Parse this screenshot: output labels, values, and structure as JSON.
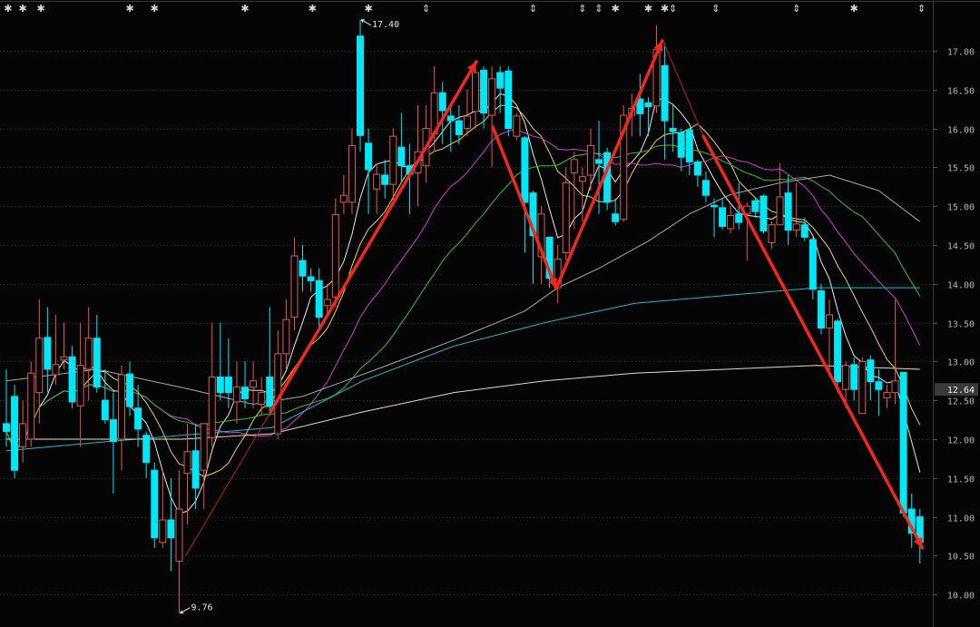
{
  "chart_data": {
    "type": "candlestick",
    "title": "",
    "ylim": [
      9.7,
      17.4
    ],
    "y_ticks": [
      "17.00",
      "16.50",
      "16.00",
      "15.50",
      "15.00",
      "14.50",
      "14.00",
      "13.50",
      "13.00",
      "12.50",
      "12.00",
      "11.50",
      "11.00",
      "10.50",
      "10.00"
    ],
    "current_price": "12.64",
    "high_label": "17.40",
    "low_label": "9.76",
    "high_value": 17.4,
    "low_value": 9.76,
    "high_index": 43,
    "low_index": 21,
    "colors": {
      "up": "#e05a50",
      "down": "#00e8f8",
      "background": "#050505",
      "grid": "#3a3a3a",
      "trend": "#f0281e",
      "trend_thin": "#a0201a"
    },
    "ohlc": [
      [
        12.2,
        12.9,
        11.9,
        12.1
      ],
      [
        12.55,
        12.7,
        11.5,
        11.6
      ],
      [
        11.9,
        12.5,
        11.7,
        12.2
      ],
      [
        12.0,
        13.0,
        11.9,
        12.85
      ],
      [
        12.6,
        13.8,
        12.2,
        13.3
      ],
      [
        13.31,
        13.7,
        12.6,
        12.9
      ],
      [
        12.83,
        13.6,
        12.7,
        12.96
      ],
      [
        13.02,
        13.5,
        12.9,
        13.06
      ],
      [
        13.06,
        13.2,
        12.4,
        12.48
      ],
      [
        12.43,
        13.5,
        11.9,
        12.95
      ],
      [
        12.9,
        13.7,
        12.5,
        13.3
      ],
      [
        13.3,
        13.6,
        12.6,
        12.67
      ],
      [
        12.5,
        12.9,
        12.2,
        12.25
      ],
      [
        12.25,
        12.6,
        11.3,
        11.97
      ],
      [
        12.0,
        12.95,
        11.6,
        12.83
      ],
      [
        12.84,
        13.0,
        12.3,
        12.42
      ],
      [
        12.4,
        12.7,
        11.9,
        12.13
      ],
      [
        12.05,
        12.1,
        11.5,
        11.7
      ],
      [
        11.6,
        11.7,
        10.6,
        10.73
      ],
      [
        10.67,
        11.6,
        10.6,
        10.96
      ],
      [
        10.96,
        11.5,
        10.3,
        10.73
      ],
      [
        10.43,
        11.6,
        9.76,
        11.1
      ],
      [
        11.56,
        12.2,
        10.9,
        11.84
      ],
      [
        11.85,
        12.2,
        11.1,
        11.37
      ],
      [
        11.6,
        12.2,
        11.1,
        12.2
      ],
      [
        12.02,
        13.5,
        11.9,
        12.8
      ],
      [
        12.8,
        13.5,
        12.5,
        12.6
      ],
      [
        12.8,
        13.3,
        12.4,
        12.6
      ],
      [
        12.48,
        13.0,
        12.2,
        12.67
      ],
      [
        12.67,
        13.0,
        12.4,
        12.52
      ],
      [
        12.67,
        13.0,
        12.4,
        12.75
      ],
      [
        12.45,
        12.8,
        12.3,
        12.6
      ],
      [
        12.8,
        13.7,
        12.3,
        12.42
      ],
      [
        12.07,
        13.4,
        12.0,
        13.1
      ],
      [
        13.1,
        13.8,
        12.9,
        13.54
      ],
      [
        13.57,
        14.6,
        13.4,
        14.36
      ],
      [
        14.3,
        14.5,
        13.9,
        14.1
      ],
      [
        14.09,
        14.2,
        13.9,
        14.04
      ],
      [
        14.04,
        14.2,
        13.4,
        13.57
      ],
      [
        13.72,
        14.0,
        13.6,
        13.8
      ],
      [
        13.83,
        15.1,
        13.7,
        14.89
      ],
      [
        15.05,
        15.4,
        14.9,
        15.14
      ],
      [
        15.05,
        16.0,
        14.9,
        15.78
      ],
      [
        17.19,
        17.4,
        15.7,
        15.91
      ],
      [
        15.81,
        16.0,
        14.9,
        15.47
      ],
      [
        15.22,
        15.55,
        14.9,
        15.41
      ],
      [
        15.4,
        15.6,
        15.1,
        15.28
      ],
      [
        15.28,
        16.0,
        15.0,
        15.9
      ],
      [
        15.76,
        16.2,
        15.3,
        15.52
      ],
      [
        15.52,
        15.8,
        14.9,
        15.41
      ],
      [
        15.43,
        16.3,
        15.0,
        15.7
      ],
      [
        15.52,
        16.3,
        15.3,
        16.0
      ],
      [
        15.93,
        16.8,
        15.7,
        16.46
      ],
      [
        16.46,
        16.6,
        15.8,
        16.23
      ],
      [
        16.16,
        16.3,
        15.7,
        16.1
      ],
      [
        16.1,
        16.3,
        15.8,
        15.92
      ],
      [
        16.0,
        16.5,
        15.9,
        16.16
      ],
      [
        16.22,
        16.85,
        16.0,
        16.72
      ],
      [
        16.75,
        16.8,
        16.0,
        16.2
      ],
      [
        16.17,
        16.8,
        15.5,
        16.64
      ],
      [
        16.72,
        16.8,
        16.2,
        16.52
      ],
      [
        16.74,
        16.8,
        15.9,
        16.0
      ],
      [
        15.9,
        16.2,
        15.85,
        16.16
      ],
      [
        15.88,
        15.9,
        14.4,
        15.05
      ],
      [
        15.17,
        15.2,
        14.0,
        14.62
      ],
      [
        14.35,
        15.0,
        14.0,
        14.9
      ],
      [
        14.6,
        14.6,
        13.95,
        14.07
      ],
      [
        13.95,
        14.5,
        13.75,
        14.32
      ],
      [
        14.4,
        15.5,
        14.3,
        15.3
      ],
      [
        15.43,
        15.7,
        14.7,
        15.6
      ],
      [
        15.32,
        15.5,
        14.8,
        15.38
      ],
      [
        15.4,
        16.0,
        15.2,
        15.78
      ],
      [
        15.6,
        16.1,
        14.9,
        15.55
      ],
      [
        15.69,
        15.75,
        14.95,
        15.05
      ],
      [
        14.9,
        15.1,
        14.75,
        14.8
      ],
      [
        14.83,
        16.3,
        14.8,
        16.17
      ],
      [
        16.17,
        16.45,
        15.9,
        16.26
      ],
      [
        16.38,
        16.7,
        15.9,
        16.19
      ],
      [
        16.33,
        16.4,
        15.9,
        16.28
      ],
      [
        16.29,
        17.33,
        16.2,
        17.02
      ],
      [
        16.81,
        17.1,
        15.6,
        16.1
      ],
      [
        16.0,
        16.3,
        15.7,
        15.96
      ],
      [
        15.95,
        16.0,
        15.45,
        15.63
      ],
      [
        15.98,
        16.0,
        15.4,
        15.57
      ],
      [
        15.57,
        15.6,
        15.25,
        15.4
      ],
      [
        15.33,
        15.45,
        15.05,
        15.14
      ],
      [
        15.01,
        15.1,
        14.6,
        15.0
      ],
      [
        14.98,
        15.1,
        14.7,
        14.74
      ],
      [
        14.71,
        15.0,
        14.65,
        14.88
      ],
      [
        14.9,
        15.3,
        14.7,
        14.79
      ],
      [
        14.9,
        15.05,
        14.3,
        15.0
      ],
      [
        15.07,
        15.1,
        14.85,
        14.93
      ],
      [
        15.13,
        15.15,
        14.65,
        14.68
      ],
      [
        14.53,
        14.8,
        14.45,
        14.76
      ],
      [
        14.76,
        15.55,
        14.76,
        15.12
      ],
      [
        15.17,
        15.4,
        14.5,
        14.69
      ],
      [
        14.69,
        15.3,
        14.6,
        14.77
      ],
      [
        14.76,
        14.85,
        14.55,
        14.6
      ],
      [
        14.57,
        14.6,
        13.8,
        13.93
      ],
      [
        13.91,
        14.0,
        13.35,
        13.43
      ],
      [
        13.43,
        13.8,
        12.8,
        13.6
      ],
      [
        13.52,
        13.55,
        12.6,
        12.74
      ],
      [
        12.64,
        13.0,
        12.4,
        12.95
      ],
      [
        12.96,
        13.05,
        12.5,
        12.64
      ],
      [
        12.33,
        13.05,
        12.33,
        13.0
      ],
      [
        13.02,
        13.08,
        12.5,
        12.74
      ],
      [
        12.74,
        12.9,
        12.3,
        12.64
      ],
      [
        12.53,
        12.7,
        12.4,
        12.6
      ],
      [
        12.6,
        13.8,
        12.45,
        12.75
      ],
      [
        12.86,
        12.86,
        11.0,
        11.05
      ],
      [
        11.1,
        11.3,
        10.6,
        10.79
      ],
      [
        11.0,
        11.1,
        10.4,
        10.67
      ]
    ],
    "moving_averages": [
      {
        "name": "MA5",
        "period": 5,
        "color": "#e8e8e8"
      },
      {
        "name": "MA10",
        "period": 10,
        "color": "#e8d84a"
      },
      {
        "name": "MA20",
        "period": 20,
        "color": "#d040d8"
      },
      {
        "name": "MA30",
        "period": 30,
        "color": "#40c020"
      },
      {
        "name": "MA60",
        "color": "#a8a8a8",
        "points": [
          [
            0,
            12.75
          ],
          [
            11,
            12.9
          ],
          [
            22,
            12.65
          ],
          [
            30,
            12.45
          ],
          [
            36,
            12.55
          ],
          [
            45,
            12.9
          ],
          [
            55,
            13.3
          ],
          [
            63,
            13.65
          ],
          [
            67,
            13.95
          ],
          [
            72,
            14.2
          ],
          [
            78,
            14.55
          ],
          [
            83,
            14.9
          ],
          [
            88,
            15.15
          ],
          [
            94,
            15.3
          ],
          [
            100,
            15.4
          ],
          [
            106,
            15.2
          ],
          [
            111,
            14.8
          ]
        ]
      },
      {
        "name": "MA120",
        "color": "#20b8d0",
        "points": [
          [
            0,
            11.85
          ],
          [
            10.3,
            11.95
          ],
          [
            21.3,
            12.05
          ],
          [
            32.3,
            12.15
          ],
          [
            43.3,
            12.75
          ],
          [
            54.4,
            13.2
          ],
          [
            65.4,
            13.5
          ],
          [
            76.4,
            13.75
          ],
          [
            87.4,
            13.85
          ],
          [
            98.5,
            13.95
          ],
          [
            111,
            13.95
          ]
        ]
      },
      {
        "name": "MA250",
        "color": "#e8e0a0",
        "points": [
          [
            0,
            12.0
          ],
          [
            21.3,
            12.0
          ],
          [
            32.3,
            12.07
          ],
          [
            43.3,
            12.35
          ],
          [
            54.4,
            12.6
          ],
          [
            65.4,
            12.75
          ],
          [
            76.4,
            12.85
          ],
          [
            87.4,
            12.9
          ],
          [
            98.5,
            12.95
          ],
          [
            111,
            12.9
          ]
        ]
      }
    ],
    "trend_lines": [
      {
        "from": [
          21.8,
          10.5
        ],
        "to": [
          32.1,
          12.35
        ],
        "style": "thin",
        "arrow": false
      },
      {
        "from": [
          32.1,
          12.35
        ],
        "to": [
          57.1,
          16.86
        ],
        "style": "thick",
        "arrow": true
      },
      {
        "from": [
          59.1,
          16.02
        ],
        "to": [
          66.8,
          13.94
        ],
        "style": "thick",
        "arrow": true
      },
      {
        "from": [
          66.8,
          13.94
        ],
        "to": [
          79.7,
          17.13
        ],
        "style": "thick",
        "arrow": true
      },
      {
        "from": [
          79.9,
          17.1
        ],
        "to": [
          84.7,
          15.9
        ],
        "style": "thin",
        "arrow": false
      },
      {
        "from": [
          84.7,
          15.9
        ],
        "to": [
          111.3,
          10.6
        ],
        "style": "thick",
        "arrow": true
      }
    ],
    "event_markers": [
      {
        "index": 0.2,
        "symbol": "✱"
      },
      {
        "index": 2,
        "symbol": "✱"
      },
      {
        "index": 4.2,
        "symbol": "✱"
      },
      {
        "index": 15,
        "symbol": "✱"
      },
      {
        "index": 18,
        "symbol": "✱"
      },
      {
        "index": 29,
        "symbol": "✱"
      },
      {
        "index": 37.2,
        "symbol": "✱"
      },
      {
        "index": 44,
        "symbol": "✱"
      },
      {
        "index": 51,
        "symbol": "⇕"
      },
      {
        "index": 64,
        "symbol": "⇕"
      },
      {
        "index": 70,
        "symbol": "⇕"
      },
      {
        "index": 72,
        "symbol": "⇕"
      },
      {
        "index": 74,
        "symbol": "✱"
      },
      {
        "index": 78,
        "symbol": "✱"
      },
      {
        "index": 80,
        "symbol": "✱"
      },
      {
        "index": 81,
        "symbol": "⇕"
      },
      {
        "index": 86.2,
        "symbol": "⇕"
      },
      {
        "index": 96,
        "symbol": "⇕"
      },
      {
        "index": 103,
        "symbol": "✱"
      },
      {
        "index": 111.2,
        "symbol": "⇕"
      }
    ]
  }
}
